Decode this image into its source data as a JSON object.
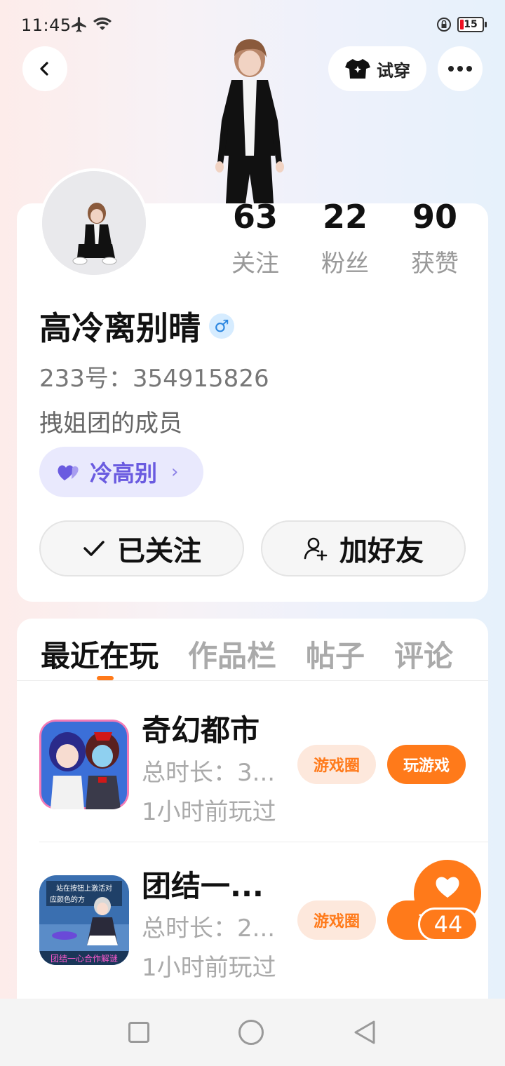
{
  "status_bar": {
    "time": "11:45",
    "battery": "15"
  },
  "header": {
    "try_on_label": "试穿"
  },
  "stats": [
    {
      "value": "63",
      "label": "关注"
    },
    {
      "value": "22",
      "label": "粉丝"
    },
    {
      "value": "90",
      "label": "获赞"
    }
  ],
  "profile": {
    "name": "高冷离别晴",
    "gender_symbol": "♂",
    "uid": "233号：354915826",
    "bio": "拽姐团的成员",
    "cp_label": "冷高别",
    "cp_chevron": "›"
  },
  "actions": {
    "follow_label": "已关注",
    "add_friend_label": "加好友"
  },
  "tabs": [
    "最近在玩",
    "作品栏",
    "帖子",
    "评论"
  ],
  "games": [
    {
      "title": "奇幻都市",
      "duration": "总时长：3...",
      "last_played": "1小时前玩过",
      "circle_label": "游戏圈",
      "play_label": "玩游戏"
    },
    {
      "title": "团结一...",
      "duration": "总时长：2...",
      "last_played": "1小时前玩过",
      "circle_label": "游戏圈",
      "play_label": "玩"
    }
  ],
  "game2_icon_text": {
    "line1": "站在按钮上激活对",
    "line2": "应颜色的方",
    "banner": "团结一心合作解谜"
  },
  "like": {
    "count": "44"
  },
  "colors": {
    "accent": "#ff7a1a",
    "cp_purple": "#6a5be0",
    "gender_blue": "#2b86e0"
  }
}
